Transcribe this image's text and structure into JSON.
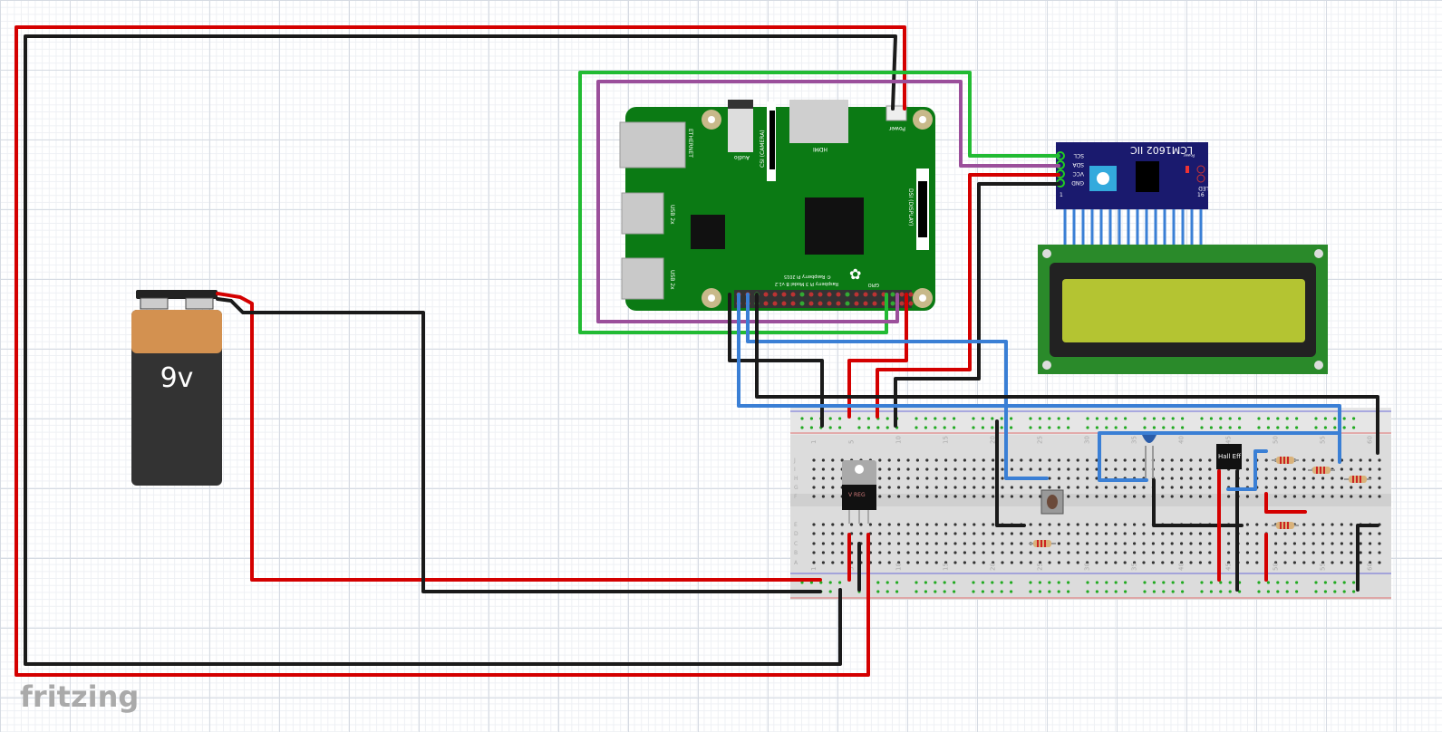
{
  "app": {
    "logo": "fritzing"
  },
  "battery": {
    "label": "9v"
  },
  "raspberry_pi": {
    "ethernet": "ETHERNET",
    "audio": "Audio",
    "csi": "CSI (CAMERA)",
    "hdmi": "HDMI",
    "power": "Power",
    "dsi": "DSI (DISPLAY)",
    "usb1": "USB 2x",
    "usb2": "USB 2x",
    "model": "Raspberry Pi 3 Model B v1.2",
    "copyright": "© Raspberry Pi 2015",
    "gpio": "GPIO"
  },
  "lcd_module": {
    "title": "LCM1602 IIC",
    "pins": [
      "SCL",
      "SDA",
      "VCC",
      "GND"
    ],
    "power": "Power",
    "led": "LED",
    "pin_first": "1",
    "pin_last": "16"
  },
  "breadboard": {
    "column_labels": [
      "1",
      "5",
      "10",
      "15",
      "20",
      "25",
      "30",
      "35",
      "40",
      "45",
      "50",
      "55",
      "60"
    ],
    "row_labels_top": [
      "J",
      "I",
      "H",
      "G",
      "F"
    ],
    "row_labels_bottom": [
      "E",
      "D",
      "C",
      "B",
      "A"
    ]
  },
  "components": {
    "regulator": "V REG",
    "hall_sensor": "Hall Eff"
  },
  "colors": {
    "pi_board": "#0b7a14",
    "lcd_module": "#1a1a6e",
    "lcd_screen": "#b4c432",
    "lcd_pcb": "#2a8a2a"
  }
}
